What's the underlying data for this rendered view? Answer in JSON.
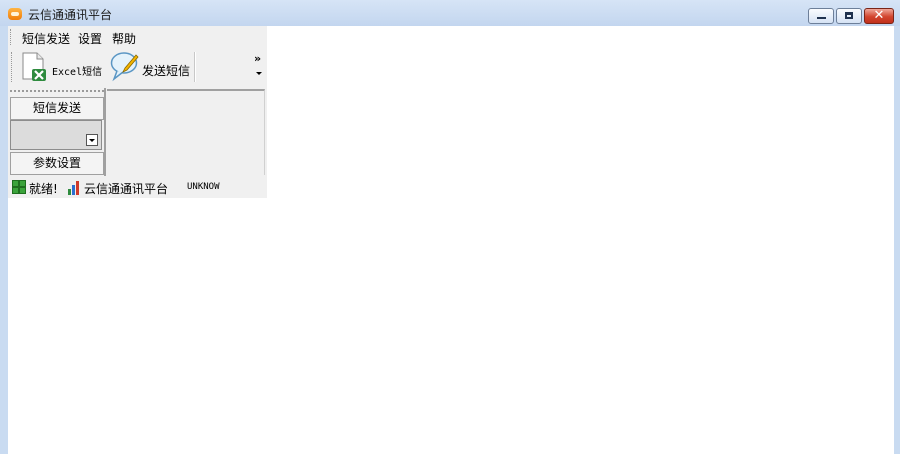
{
  "window": {
    "title": "云信通通讯平台",
    "icon": "app-logo-icon",
    "controls": [
      "minimize-icon",
      "maximize-icon",
      "close-icon"
    ]
  },
  "menu": {
    "items": [
      "短信发送",
      "设置",
      "帮助"
    ]
  },
  "toolbar": {
    "buttons": [
      {
        "label": "Excel短信",
        "icon": "excel-document-icon"
      },
      {
        "label": "发送短信",
        "icon": "speech-bubble-pencil-icon"
      }
    ],
    "overflow": "»"
  },
  "navigator": {
    "header": "短信发送",
    "footer": "参数设置",
    "combo_value": ""
  },
  "status": {
    "ready": "就绪!",
    "platform": "云信通通讯平台",
    "state": "UNKNOW"
  }
}
